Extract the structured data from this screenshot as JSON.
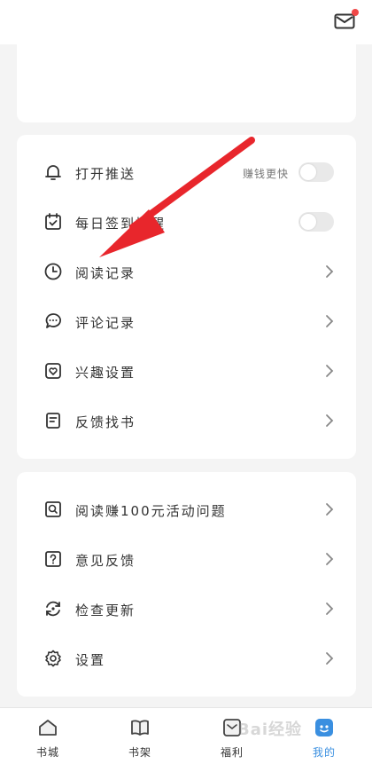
{
  "colors": {
    "accent": "#3a8fe0",
    "notification": "#f04848",
    "arrow": "#e8262c"
  },
  "header": {
    "icon": "mail-icon",
    "has_notification": true
  },
  "settings_group": {
    "items": [
      {
        "icon": "bell-icon",
        "label": "打开推送",
        "hint": "赚钱更快",
        "control": "toggle",
        "on": false
      },
      {
        "icon": "calendar-check-icon",
        "label": "每日签到提醒",
        "control": "toggle",
        "on": false
      },
      {
        "icon": "clock-icon",
        "label": "阅读记录",
        "control": "chevron"
      },
      {
        "icon": "comment-icon",
        "label": "评论记录",
        "control": "chevron"
      },
      {
        "icon": "heart-icon",
        "label": "兴趣设置",
        "control": "chevron"
      },
      {
        "icon": "feedback-book-icon",
        "label": "反馈找书",
        "control": "chevron"
      }
    ]
  },
  "help_group": {
    "items": [
      {
        "icon": "search-doc-icon",
        "label": "阅读赚100元活动问题",
        "control": "chevron"
      },
      {
        "icon": "question-icon",
        "label": "意见反馈",
        "control": "chevron"
      },
      {
        "icon": "refresh-icon",
        "label": "检查更新",
        "control": "chevron"
      },
      {
        "icon": "gear-icon",
        "label": "设置",
        "control": "chevron"
      }
    ]
  },
  "bottom_nav": {
    "tabs": [
      {
        "label": "书城",
        "icon": "home-icon"
      },
      {
        "label": "书架",
        "icon": "book-icon"
      },
      {
        "label": "福利",
        "icon": "gift-icon"
      },
      {
        "label": "我的",
        "icon": "profile-icon",
        "active": true
      }
    ]
  },
  "watermark": "Bai经验"
}
